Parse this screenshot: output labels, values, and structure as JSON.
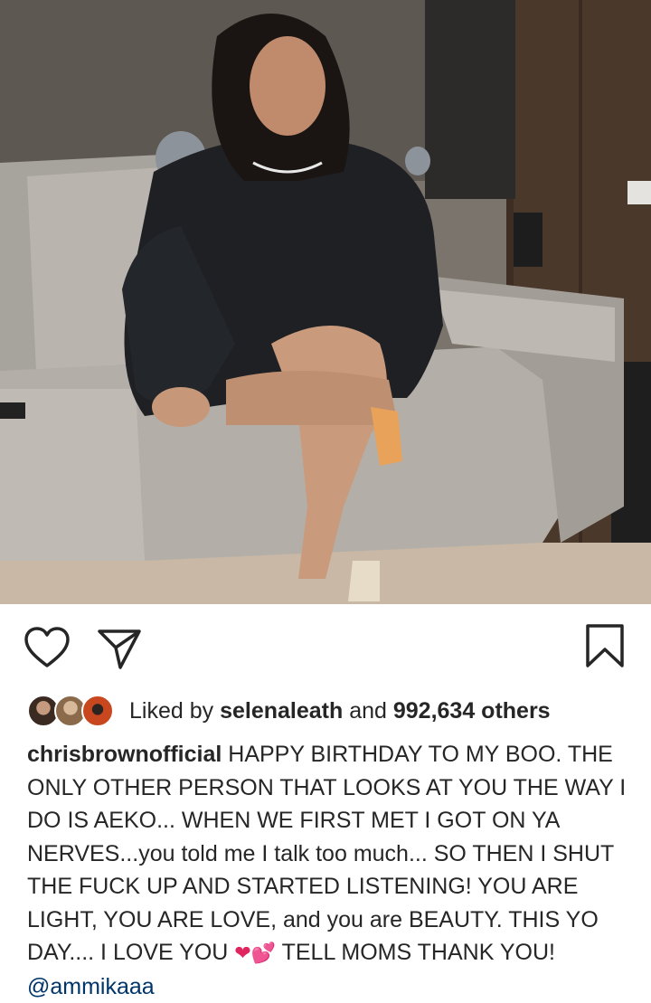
{
  "post": {
    "image_alt": "photo of a woman sitting on a grey couch"
  },
  "actions": {
    "like": "heart-icon",
    "share": "send-icon",
    "save": "bookmark-icon"
  },
  "likes": {
    "prefix": "Liked by ",
    "user": "selenaleath",
    "and": " and ",
    "count": "992,634 others"
  },
  "caption": {
    "username": "chrisbrownofficial",
    "text1": " HAPPY BIRTHDAY TO MY BOO. THE ONLY OTHER PERSON THAT LOOKS AT YOU THE WAY I DO IS AEKO... WHEN WE FIRST MET I GOT ON YA NERVES...you told me I talk too much... SO THEN I SHUT THE FUCK UP AND STARTED LISTENING! YOU ARE LIGHT, YOU ARE LOVE, and you are BEAUTY.  THIS YO DAY.... I LOVE YOU ",
    "emoji1": "❤",
    "emoji2": "💕",
    "text2": " TELL MOMS THANK YOU! ",
    "mention": "@ammikaaa"
  }
}
